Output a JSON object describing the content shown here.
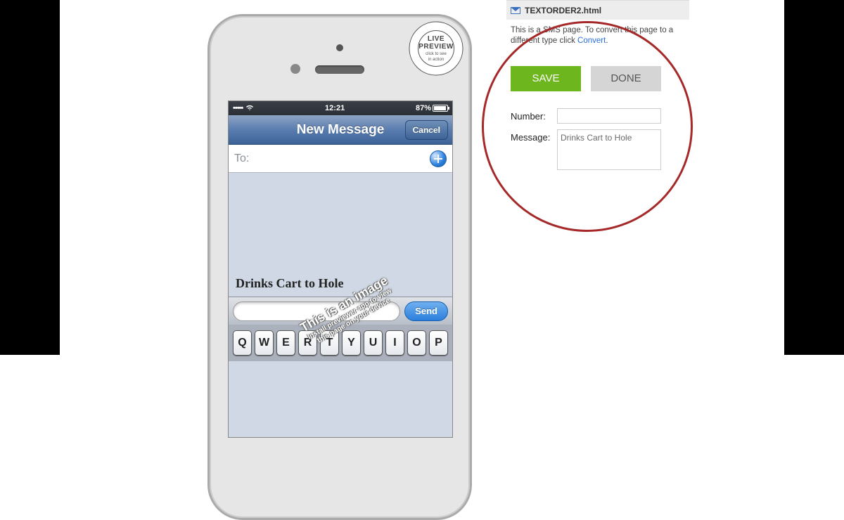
{
  "file": {
    "name": "TEXTORDER2.html"
  },
  "info": {
    "prefix": "This is a SMS page. To convert this page to a different type click ",
    "link": "Convert",
    "suffix": "."
  },
  "buttons": {
    "save": "SAVE",
    "done": "DONE"
  },
  "form": {
    "number_label": "Number:",
    "number_value": "",
    "message_label": "Message:",
    "message_value": "Drinks Cart to Hole"
  },
  "phone": {
    "status": {
      "signal": "•••••",
      "time": "12:21",
      "battery": "87%"
    },
    "nav": {
      "title": "New Message",
      "cancel": "Cancel"
    },
    "to_label": "To:",
    "message_text": "Drinks Cart to Hole",
    "send": "Send",
    "watermark": {
      "line1": "This is an image",
      "line2": "Install previewer app to view",
      "line3": "this page on your device"
    },
    "keys": [
      "Q",
      "W",
      "E",
      "R",
      "T",
      "Y",
      "U",
      "I",
      "O",
      "P"
    ]
  },
  "badge": {
    "line1": "LIVE",
    "line2": "PREVIEW",
    "sub1": "click to see",
    "sub2": "in action"
  }
}
